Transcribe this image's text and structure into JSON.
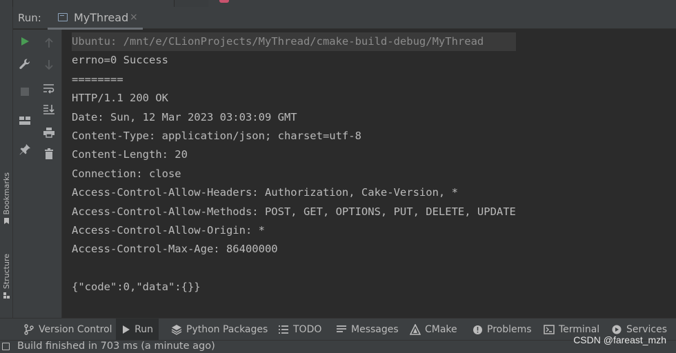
{
  "run_panel": {
    "label": "Run:",
    "tab": {
      "title": "MyThread",
      "close": "×"
    }
  },
  "side_labels": {
    "bookmarks": "Bookmarks",
    "structure": "Structure"
  },
  "console": {
    "lines": [
      "Ubuntu: /mnt/e/CLionProjects/MyThread/cmake-build-debug/MyThread",
      "errno=0 Success",
      "========",
      "HTTP/1.1 200 OK",
      "Date: Sun, 12 Mar 2023 03:03:09 GMT",
      "Content-Type: application/json; charset=utf-8",
      "Content-Length: 20",
      "Connection: close",
      "Access-Control-Allow-Headers: Authorization, Cake-Version, *",
      "Access-Control-Allow-Methods: POST, GET, OPTIONS, PUT, DELETE, UPDATE",
      "Access-Control-Allow-Origin: *",
      "Access-Control-Max-Age: 86400000",
      "",
      "{\"code\":0,\"data\":{}}"
    ]
  },
  "bottom_tabs": {
    "version_control": "Version Control",
    "run": "Run",
    "python_packages": "Python Packages",
    "todo": "TODO",
    "messages": "Messages",
    "cmake": "CMake",
    "problems": "Problems",
    "terminal": "Terminal",
    "services": "Services"
  },
  "status": {
    "text": "Build finished in 703 ms (a minute ago)"
  },
  "watermark": "CSDN @fareast_mzh",
  "colors": {
    "run_green": "#499c54",
    "icon_gray": "#afb1b3",
    "disabled_gray": "#5a5d5f",
    "tab_icon_blue": "#8da3bb"
  }
}
